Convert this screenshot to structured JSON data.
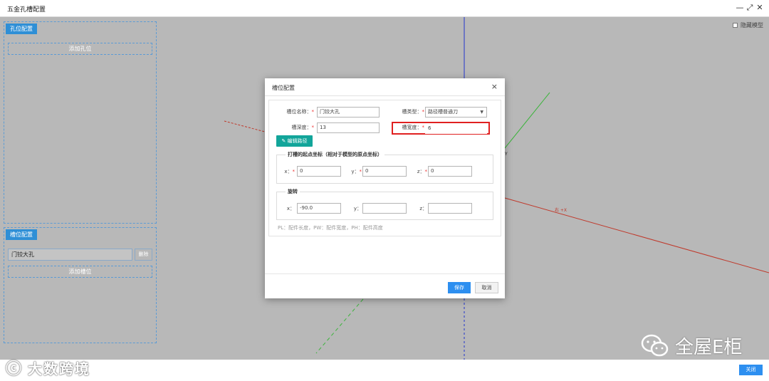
{
  "window": {
    "title": "五金孔槽配置",
    "controls": [
      "—",
      "⤢",
      "✕"
    ]
  },
  "scene": {
    "x_axis_label": "右 +X",
    "y_axis_label": "Y"
  },
  "hide_model": {
    "label": "隐藏模型"
  },
  "hole_panel": {
    "tab": "孔位配置",
    "add_label": "添加孔位"
  },
  "slot_panel": {
    "tab": "槽位配置",
    "slot_item": "门铰大孔",
    "delete_label": "删除",
    "add_label": "添加槽位"
  },
  "dialog": {
    "title": "槽位配置",
    "close": "×",
    "slot_name_label": "槽位名称：",
    "slot_name_value": "门铰大孔",
    "slot_type_label": "槽类型：",
    "slot_type_value": "路径槽普通刀",
    "slot_depth_label": "槽深度：",
    "slot_depth_value": "13",
    "slot_width_label": "槽宽度：",
    "slot_width_value": "6",
    "edit_path_label": "编辑路径",
    "start_group": {
      "legend": "打槽的起点坐标（相对于模型的原点坐标）",
      "x_label": "x：",
      "x_value": "0",
      "y_label": "y：",
      "y_value": "0",
      "z_label": "z：",
      "z_value": "0"
    },
    "rotate_group": {
      "legend": "旋转",
      "x_label": "x：",
      "x_value": "-90.0",
      "y_label": "y：",
      "y_value": "",
      "z_label": "z：",
      "z_value": ""
    },
    "note": "PL：配件长度，PW：配件宽度，PH：配件高度",
    "save_label": "保存",
    "cancel_label": "取消"
  },
  "footer": {
    "close_label": "关闭"
  },
  "watermarks": {
    "left_text": "大数跨境",
    "right_text": "全屋E柜"
  },
  "colors": {
    "accent": "#2d8ff0",
    "teal": "#12a59a",
    "highlight": "#e02020",
    "required": "#e33"
  }
}
